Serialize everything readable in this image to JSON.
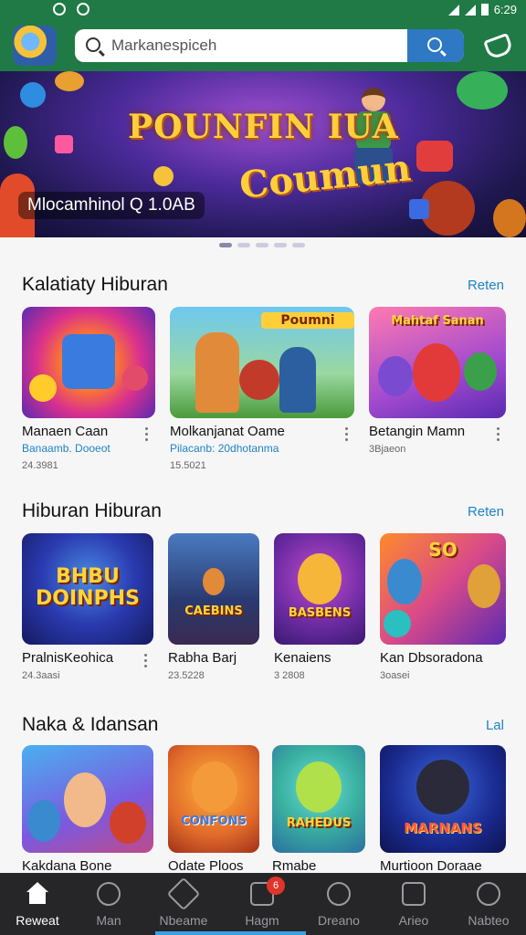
{
  "status_bar": {
    "time": "6:29"
  },
  "header": {
    "search_placeholder": "Markanespiceh"
  },
  "banner": {
    "title": "POUNFIN",
    "title_suffix": "IUA",
    "subtitle": "Coumun",
    "caption": "Mlocamhinol Q 1.0AB",
    "slide_count": 5,
    "active_slide": 1
  },
  "sections": [
    {
      "title": "Kalatiaty Hiburan",
      "more": "Reten",
      "items": [
        {
          "name": "Manaen Caan",
          "sub": "Banaamb. Dooeot",
          "meta": "24.3981"
        },
        {
          "name": "Molkanjanat Oame",
          "sub": "Pilacanb: 20dhotanma",
          "meta": "15.5021",
          "thumb_text": "Poumni"
        },
        {
          "name": "Betangin Mamn",
          "meta": "3Bjaeon",
          "thumb_text": "Mahtaf Sanan"
        }
      ]
    },
    {
      "title": "Hiburan Hiburan",
      "more": "Reten",
      "items": [
        {
          "name": "PralnisKeohica",
          "meta": "24.3aasi",
          "thumb_text": "BHBU DOINPHS"
        },
        {
          "name": "Rabha Barj",
          "meta": "23.5228",
          "thumb_text": "CAEBINS"
        },
        {
          "name": "Kenaiens",
          "meta": "3 2808",
          "thumb_text": "BASBENS"
        },
        {
          "name": "Kan Dbsoradona",
          "meta": "3oasei",
          "thumb_text": "SO"
        }
      ]
    },
    {
      "title": "Naka & Idansan",
      "more": "Lal",
      "items": [
        {
          "name": "Kakdana Bone"
        },
        {
          "name": "Odate Ploos",
          "thumb_text": "CONFONS"
        },
        {
          "name": "Rmabe",
          "thumb_text": "RAHEDUS"
        },
        {
          "name": "Murtioon Doraae",
          "thumb_text": "MARNANS"
        }
      ]
    }
  ],
  "bottom_nav": [
    {
      "label": "Reweat",
      "icon": "home-icon",
      "active": true
    },
    {
      "label": "Man",
      "icon": "search-icon"
    },
    {
      "label": "Nbeame",
      "icon": "star-icon"
    },
    {
      "label": "Hagm",
      "icon": "bag-icon",
      "badge": "6"
    },
    {
      "label": "Dreano",
      "icon": "search-icon"
    },
    {
      "label": "Arieo",
      "icon": "list-icon"
    },
    {
      "label": "Nabteo",
      "icon": "profile-icon"
    }
  ]
}
